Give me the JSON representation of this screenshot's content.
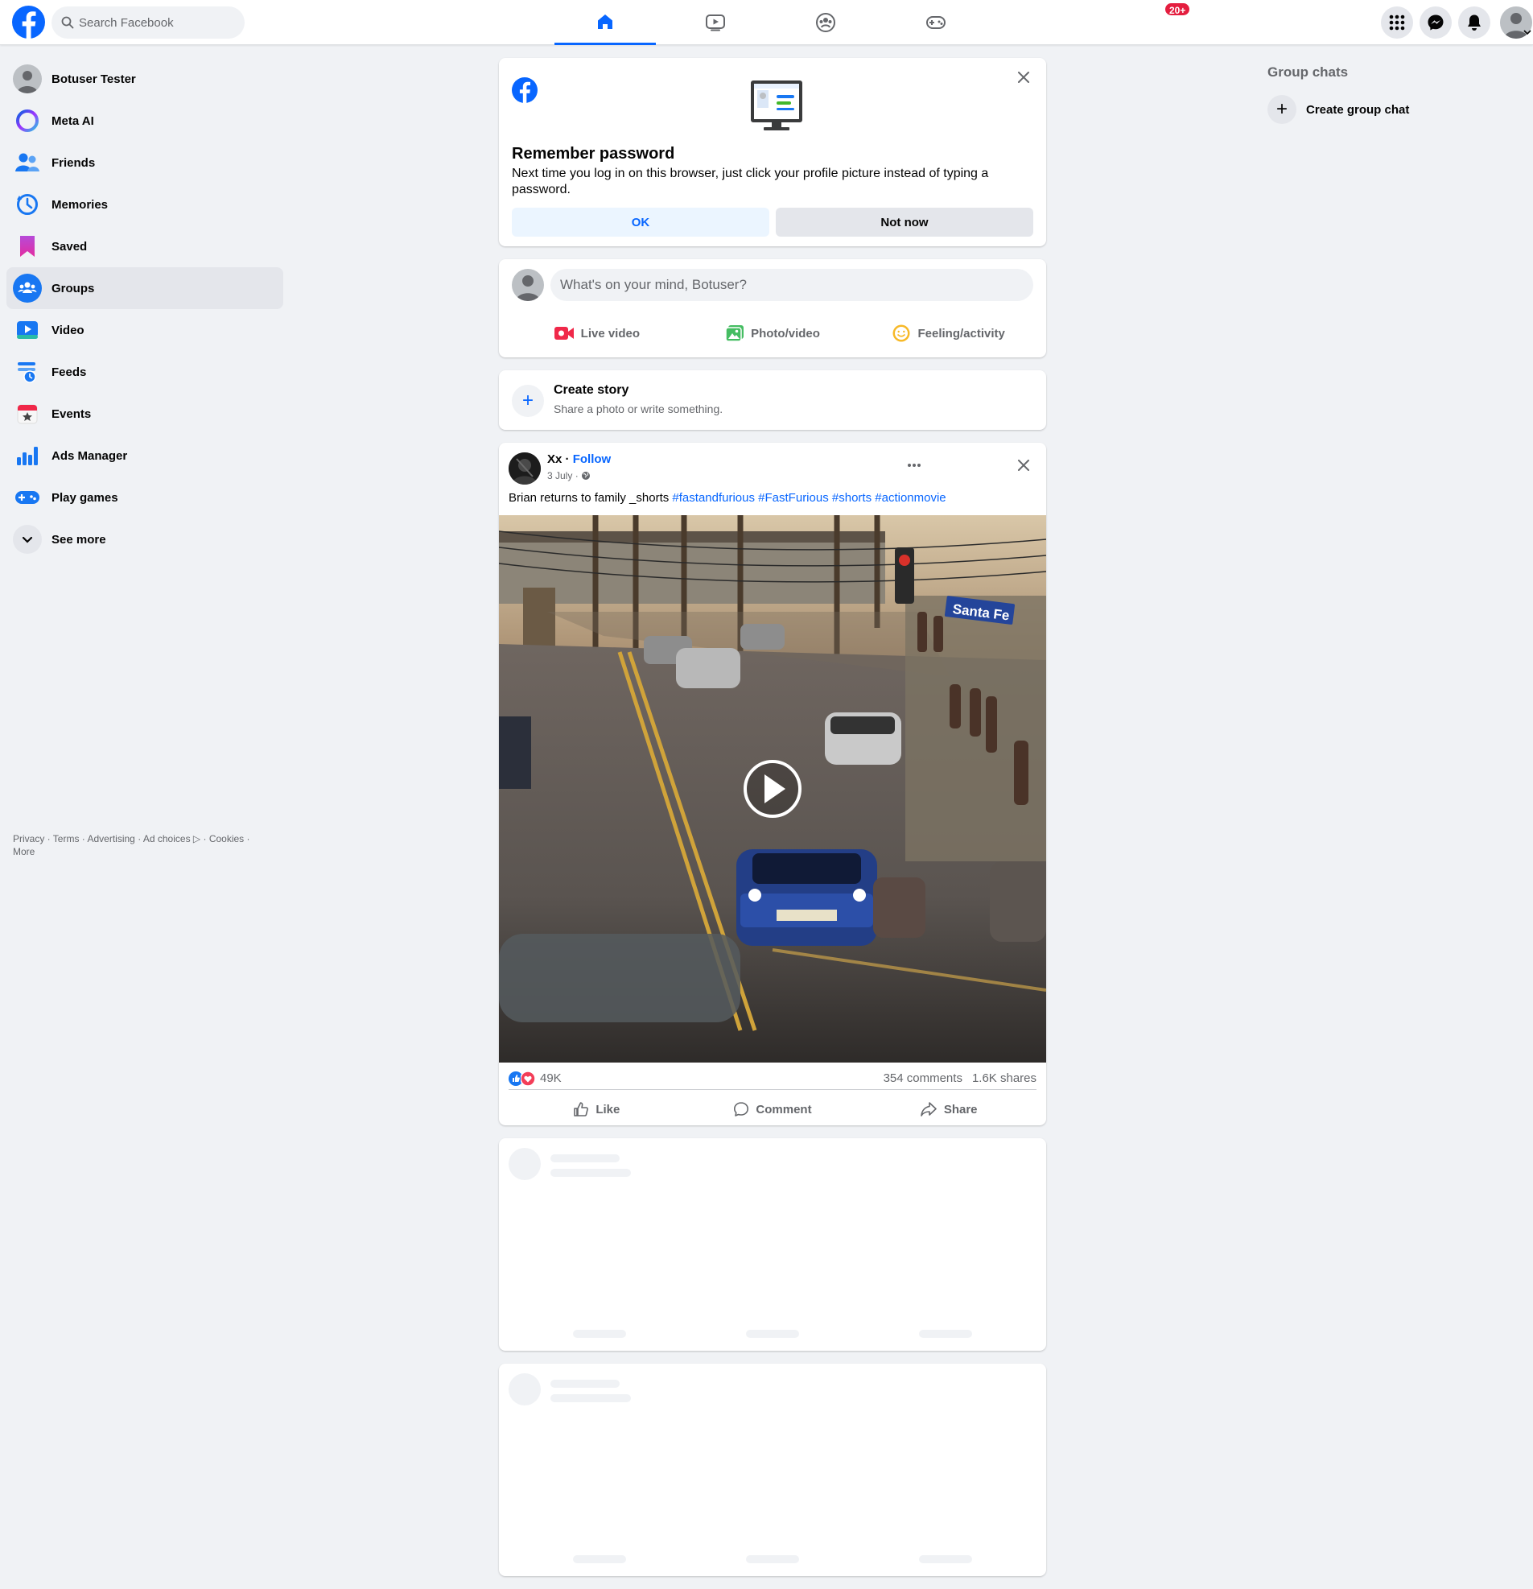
{
  "header": {
    "search_placeholder": "Search Facebook",
    "nav_tabs": [
      {
        "name": "home",
        "icon": "home-icon",
        "active": true
      },
      {
        "name": "video",
        "icon": "video-icon",
        "active": false
      },
      {
        "name": "groups",
        "icon": "groups-icon",
        "active": false
      },
      {
        "name": "gaming",
        "icon": "gaming-icon",
        "active": false
      }
    ],
    "notifications_badge": "20+"
  },
  "sidebar": {
    "items": [
      {
        "label": "Botuser Tester",
        "icon": "profile-avatar"
      },
      {
        "label": "Meta AI",
        "icon": "meta-ai-icon"
      },
      {
        "label": "Friends",
        "icon": "friends-icon"
      },
      {
        "label": "Memories",
        "icon": "memories-icon"
      },
      {
        "label": "Saved",
        "icon": "saved-icon"
      },
      {
        "label": "Groups",
        "icon": "groups-icon"
      },
      {
        "label": "Video",
        "icon": "video-icon"
      },
      {
        "label": "Feeds",
        "icon": "feeds-icon"
      },
      {
        "label": "Events",
        "icon": "events-icon"
      },
      {
        "label": "Ads Manager",
        "icon": "ads-manager-icon"
      },
      {
        "label": "Play games",
        "icon": "play-games-icon"
      },
      {
        "label": "See more",
        "icon": "chevron-down-icon"
      }
    ],
    "footer": {
      "privacy": "Privacy",
      "terms": "Terms",
      "advertising": "Advertising",
      "ad_choices": "Ad choices",
      "cookies": "Cookies",
      "more": "More"
    }
  },
  "rail": {
    "title": "Group chats",
    "create_label": "Create group chat"
  },
  "remember_password": {
    "title": "Remember password",
    "text": "Next time you log in on this browser, just click your profile picture instead of typing a password.",
    "ok_label": "OK",
    "not_now_label": "Not now"
  },
  "composer": {
    "placeholder": "What's on your mind, Botuser?",
    "actions": [
      "Live video",
      "Photo/video",
      "Feeling/activity"
    ]
  },
  "story": {
    "title": "Create story",
    "subtitle": "Share a photo or write something."
  },
  "post": {
    "author": "Xx",
    "follow_label": "Follow",
    "date": "3 July",
    "text": "Brian returns to family _shorts",
    "hashtags": [
      "#fastandfurious",
      "#FastFurious",
      "#shorts",
      "#actionmovie"
    ],
    "video_sign": "Santa Fe",
    "reactions_count": "49K",
    "comments_count": "354 comments",
    "shares_count": "1.6K shares",
    "actions": [
      "Like",
      "Comment",
      "Share"
    ]
  },
  "colors": {
    "brand": "#0866ff",
    "background": "#f0f2f5",
    "badge": "#e41e3f"
  }
}
